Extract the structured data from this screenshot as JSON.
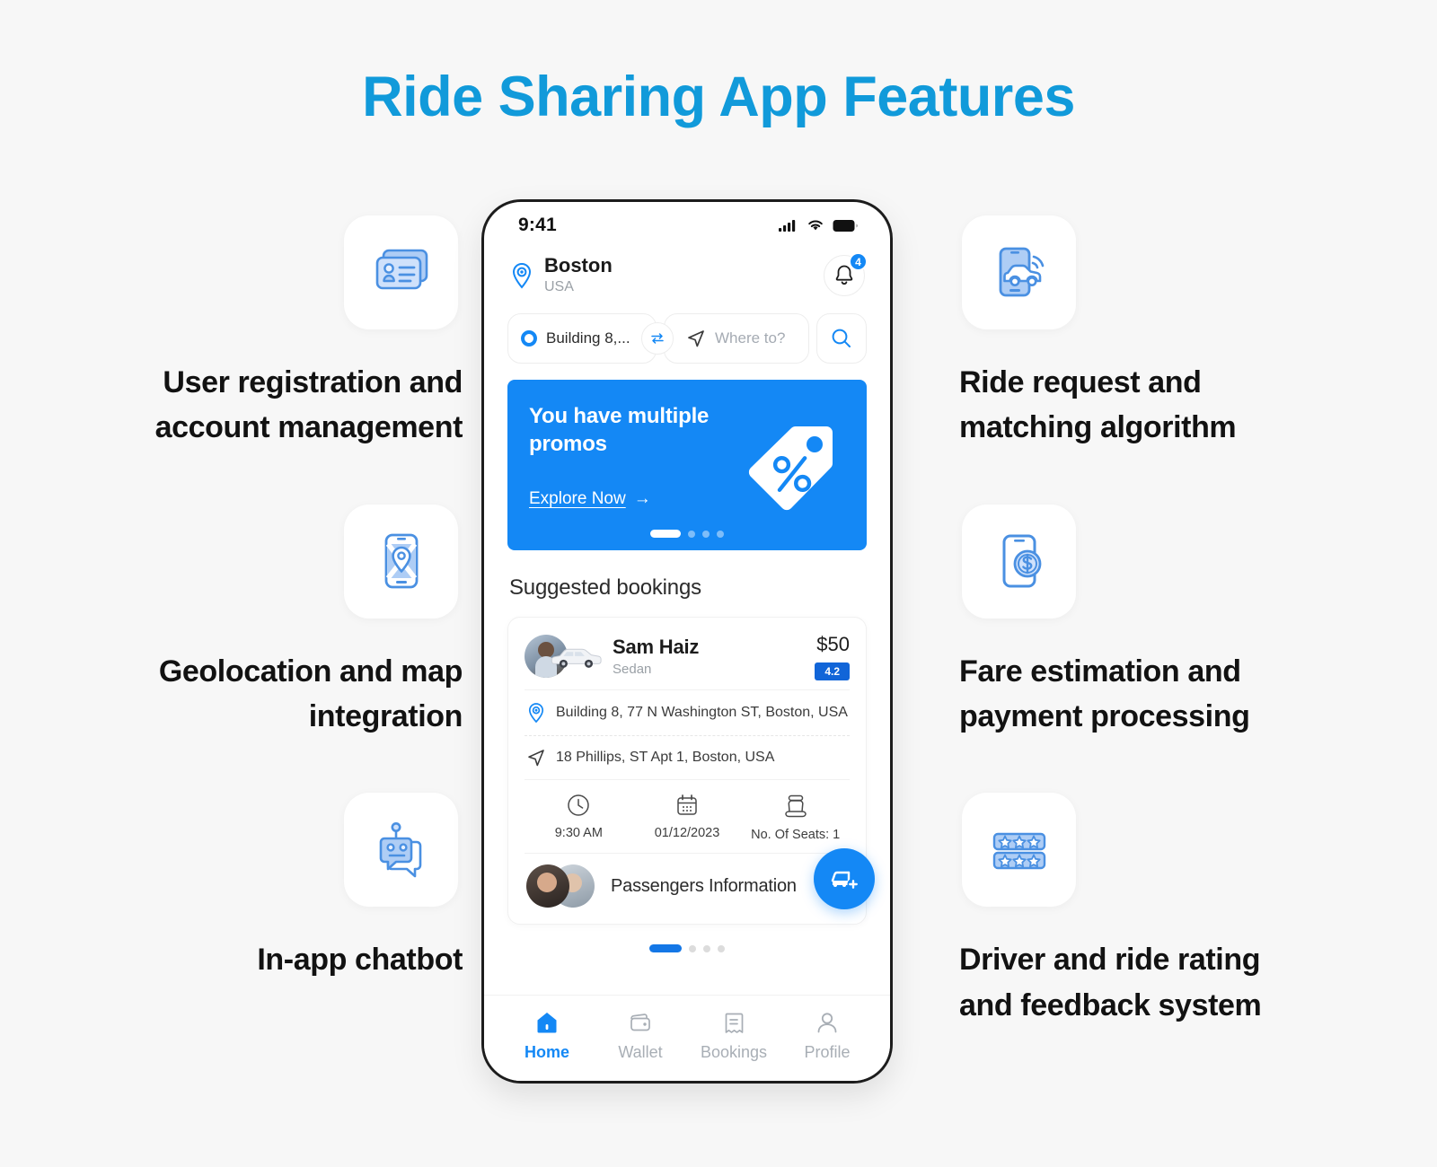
{
  "title": "Ride Sharing App Features",
  "colors": {
    "title_blue": "#119ada",
    "accent_blue": "#1488f5",
    "rating_blue": "#1165d8",
    "icon_blue": "#4a90e2",
    "icon_fill": "#aecdf5",
    "text_dark": "#121212",
    "background": "#f7f7f7"
  },
  "features": {
    "left": [
      {
        "icon": "id-cards-icon",
        "label": "User registration and account management"
      },
      {
        "icon": "phone-map-pin-icon",
        "label": "Geolocation and map integration"
      },
      {
        "icon": "chatbot-robot-icon",
        "label": "In-app chatbot"
      }
    ],
    "right": [
      {
        "icon": "phone-car-signal-icon",
        "label": "Ride request and matching algorithm"
      },
      {
        "icon": "phone-dollar-coin-icon",
        "label": "Fare estimation and payment processing"
      },
      {
        "icon": "star-rating-rows-icon",
        "label": "Driver and ride rating and feedback system"
      }
    ]
  },
  "phone": {
    "status": {
      "time": "9:41",
      "icons": [
        "cellular-signal-icon",
        "wifi-icon",
        "battery-icon"
      ]
    },
    "location": {
      "pin_icon": "location-pin-icon",
      "city": "Boston",
      "country": "USA",
      "bell_icon": "notification-bell-icon",
      "bell_badge": "4"
    },
    "search": {
      "from_value": "Building 8,...",
      "to_placeholder": "Where to?",
      "swap_icon": "swap-arrows-icon",
      "nav_icon": "navigation-arrow-icon",
      "search_icon": "search-icon"
    },
    "promo": {
      "title": "You have multiple promos",
      "link": "Explore Now",
      "arrow": "→",
      "tag_icon": "percent-tag-icon",
      "dots": 4,
      "active_dot": 0
    },
    "section_title": "Suggested bookings",
    "booking": {
      "driver_name": "Sam Haiz",
      "vehicle_type": "Sedan",
      "price": "$50",
      "rating": "4.2",
      "pickup_icon": "location-pin-icon",
      "pickup": "Building 8, 77 N Washington ST, Boston, USA",
      "dropoff_icon": "navigation-arrow-icon",
      "dropoff": "18 Phillips, ST Apt 1, Boston, USA",
      "meta": [
        {
          "icon": "clock-icon",
          "label": "9:30 AM"
        },
        {
          "icon": "calendar-icon",
          "label": "01/12/2023"
        },
        {
          "icon": "car-seat-icon",
          "label": "No. Of Seats: 1"
        }
      ],
      "passengers_label": "Passengers Information",
      "fab_icon": "add-ride-icon"
    },
    "card_dots": 4,
    "card_active_dot": 0,
    "tabs": [
      {
        "icon": "home-icon",
        "label": "Home",
        "active": true
      },
      {
        "icon": "wallet-icon",
        "label": "Wallet",
        "active": false
      },
      {
        "icon": "bookings-icon",
        "label": "Bookings",
        "active": false
      },
      {
        "icon": "profile-icon",
        "label": "Profile",
        "active": false
      }
    ]
  }
}
